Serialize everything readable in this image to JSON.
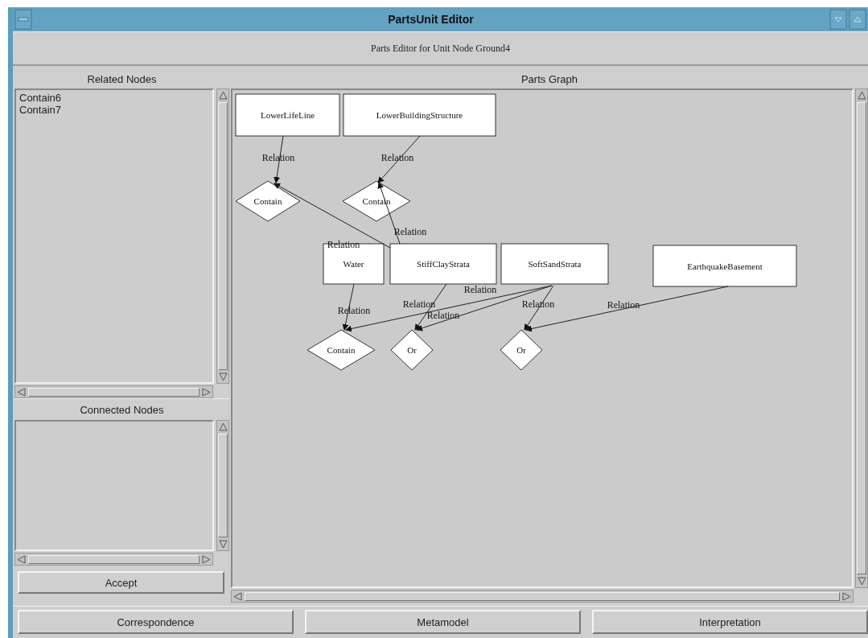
{
  "window": {
    "title": "PartsUnit Editor"
  },
  "subtitle": "Parts Editor for Unit Node Ground4",
  "related_nodes": {
    "heading": "Related Nodes",
    "items": [
      "Contain6",
      "Contain7"
    ]
  },
  "connected_nodes": {
    "heading": "Connected Nodes"
  },
  "accept_button": "Accept",
  "parts_graph": {
    "heading": "Parts Graph",
    "nodes": [
      {
        "kind": "box",
        "label": "LowerLifeLine"
      },
      {
        "kind": "box",
        "label": "LowerBuildingStructure"
      },
      {
        "kind": "diamond",
        "label": "Contain"
      },
      {
        "kind": "diamond",
        "label": "Contain"
      },
      {
        "kind": "box",
        "label": "Water"
      },
      {
        "kind": "box",
        "label": "StiffClayStrata"
      },
      {
        "kind": "box",
        "label": "SoftSandStrata"
      },
      {
        "kind": "box",
        "label": "EarthquakeBasement"
      },
      {
        "kind": "diamond",
        "label": "Contain"
      },
      {
        "kind": "diamond",
        "label": "Or"
      },
      {
        "kind": "diamond",
        "label": "Or"
      }
    ],
    "edges": [
      {
        "label": "Relation"
      },
      {
        "label": "Relation"
      },
      {
        "label": "Relation"
      },
      {
        "label": "Relation"
      },
      {
        "label": "Relation"
      },
      {
        "label": "Relation"
      },
      {
        "label": "Relation"
      },
      {
        "label": "Relation"
      },
      {
        "label": "Relation"
      },
      {
        "label": "Relation"
      }
    ]
  },
  "buttons": [
    "Correspondence",
    "Metamodel",
    "Interpretation"
  ]
}
